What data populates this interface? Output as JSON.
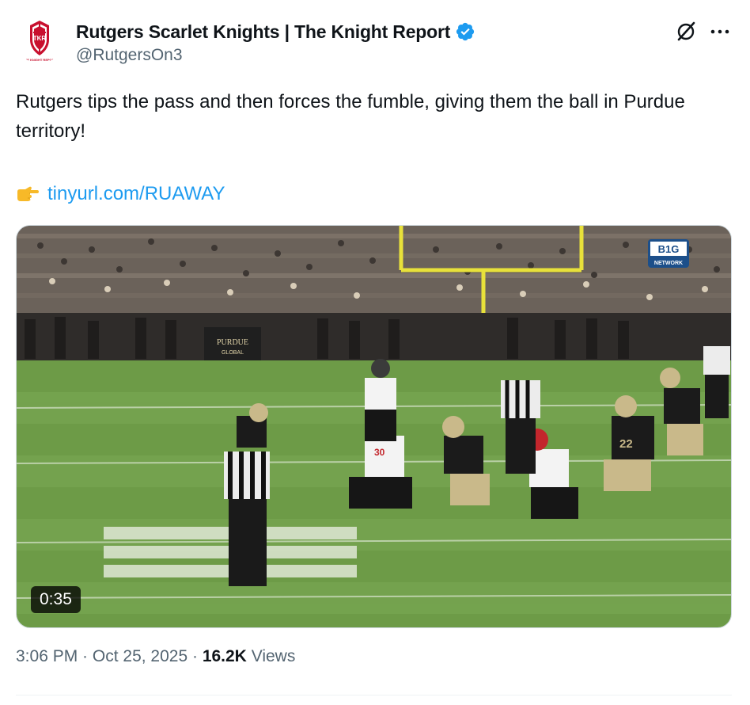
{
  "author": {
    "display_name": "Rutgers Scarlet Knights | The Knight Report",
    "handle": "@RutgersOn3",
    "avatar_icon": "knight-report-shield-logo",
    "avatar_caption": "THE KNIGHT REPORT",
    "verified": true,
    "verified_color": "#1d9bf0"
  },
  "actions": {
    "grok_icon": "grok-icon",
    "more_icon": "more-icon"
  },
  "tweet": {
    "text": "Rutgers tips the pass and then forces the fumble, giving them the ball in Purdue territory!",
    "link_emoji": "pointing-right-icon",
    "link_text": "tinyurl.com/RUAWAY",
    "link_color": "#1d9bf0"
  },
  "media": {
    "type": "video",
    "duration": "0:35",
    "network_logo_line1": "B1G",
    "network_logo_line2": "NETWORK",
    "stadium_sign": "PURDUE GLOBAL",
    "jersey_numbers": [
      "30",
      "22"
    ]
  },
  "meta": {
    "time": "3:06 PM",
    "separator": " · ",
    "date": "Oct 25, 2025",
    "views_count": "16.2K",
    "views_label": "Views"
  }
}
